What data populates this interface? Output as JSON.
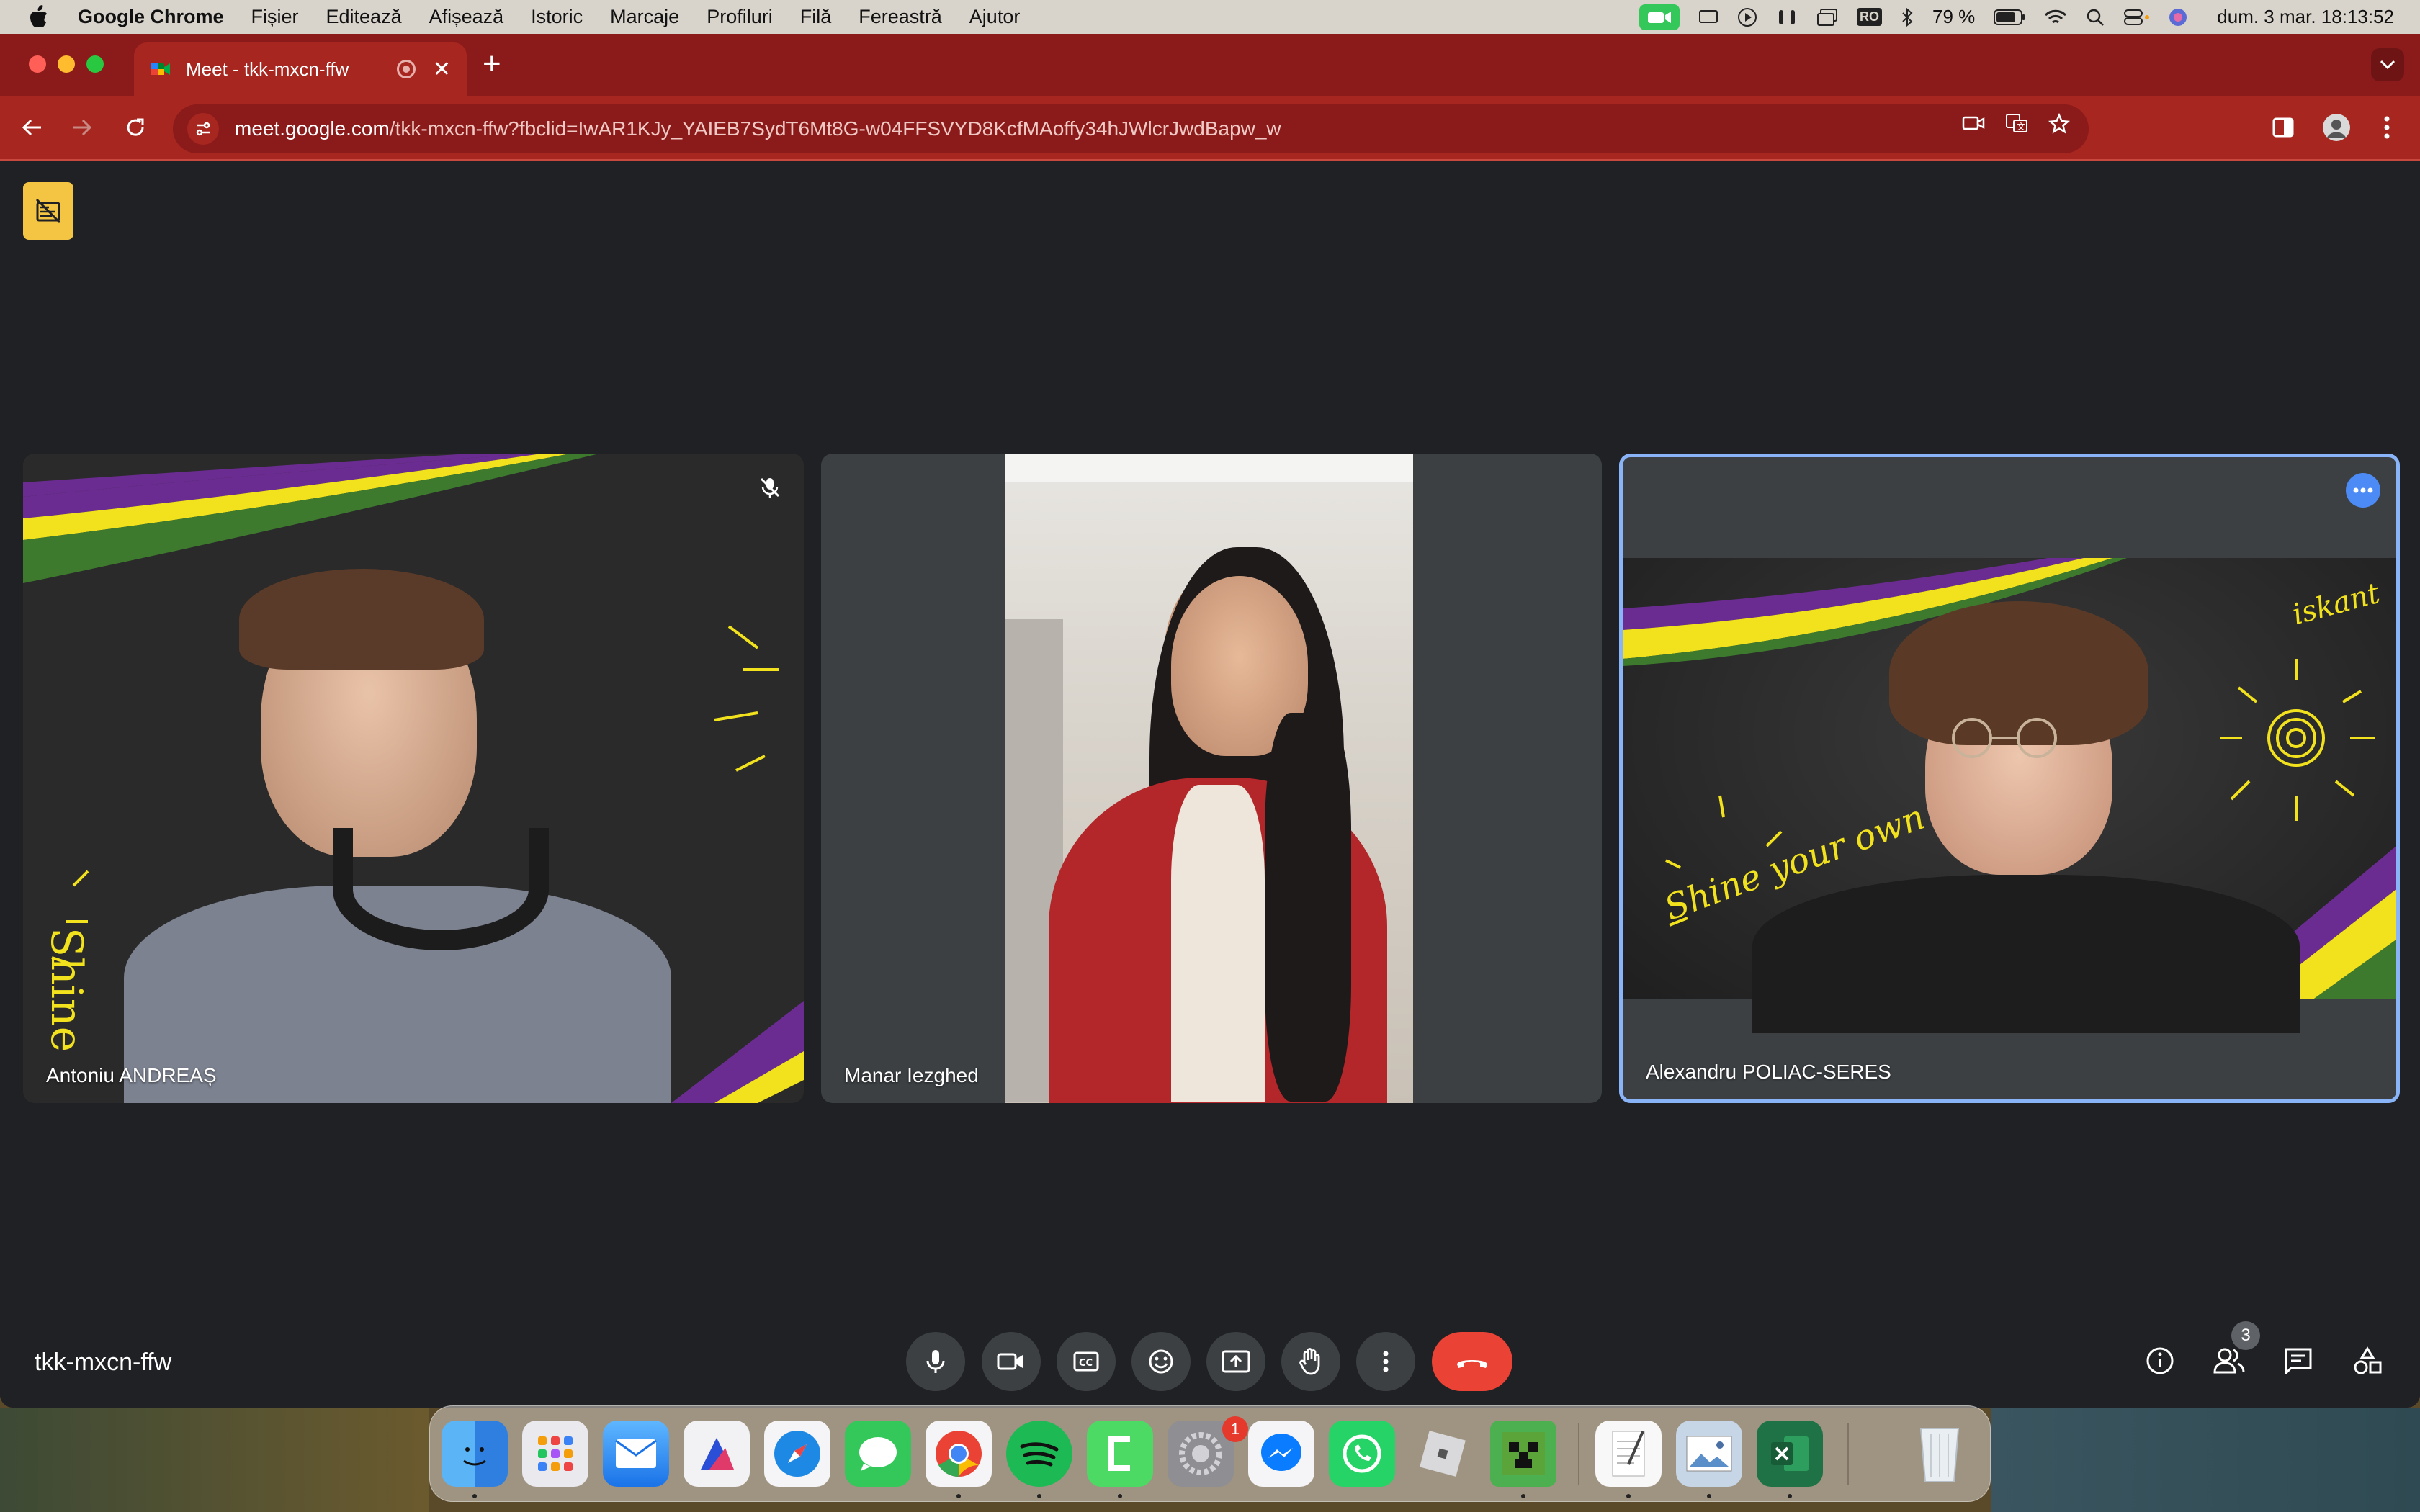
{
  "menubar": {
    "app": "Google Chrome",
    "items": [
      "Fișier",
      "Editează",
      "Afișează",
      "Istoric",
      "Marcaje",
      "Profiluri",
      "Filă",
      "Fereastră",
      "Ajutor"
    ],
    "battery": "79 %",
    "input_source": "RO",
    "clock": "dum. 3 mar.  18:13:52"
  },
  "browser": {
    "tab_title": "Meet - tkk-mxcn-ffw",
    "url_host": "meet.google.com",
    "url_path": "/tkk-mxcn-ffw?fbclid=IwAR1KJy_YAIEB7SydT6Mt8G-w04FFSVYD8KcfMAoffy34hJWlcrJwdBapw_w"
  },
  "meet": {
    "participants": [
      {
        "name": "Antoniu ANDREAȘ",
        "muted": true
      },
      {
        "name": "Manar Iezghed",
        "muted": false
      },
      {
        "name": "Alexandru POLIAC-SERES",
        "muted": false,
        "active": true
      }
    ],
    "meeting_code": "tkk-mxcn-ffw",
    "participant_count": "3",
    "background_text": "Shine your own LIGHT",
    "logo_text": "iskant"
  },
  "dock": {
    "apps": [
      "Finder",
      "Launchpad",
      "Mail",
      "Affinity",
      "Safari",
      "Messages",
      "Chrome",
      "Spotify",
      "Camo",
      "System Settings",
      "Messenger",
      "WhatsApp",
      "Roblox",
      "Minecraft",
      "TextEdit",
      "Preview",
      "Excel",
      "Trash"
    ],
    "settings_badge": "1"
  },
  "colors": {
    "menubar": "#d8d4cc",
    "tabstrip": "#8b1a1a",
    "toolbar": "#a7261f",
    "meet_bg": "#202124",
    "tile_bg": "#3c4043",
    "active_border": "#8ab4f8",
    "end_call": "#ea4335",
    "stripe_purple": "#6a2c91",
    "stripe_yellow": "#f2e21e",
    "stripe_green": "#3e7a2e"
  }
}
